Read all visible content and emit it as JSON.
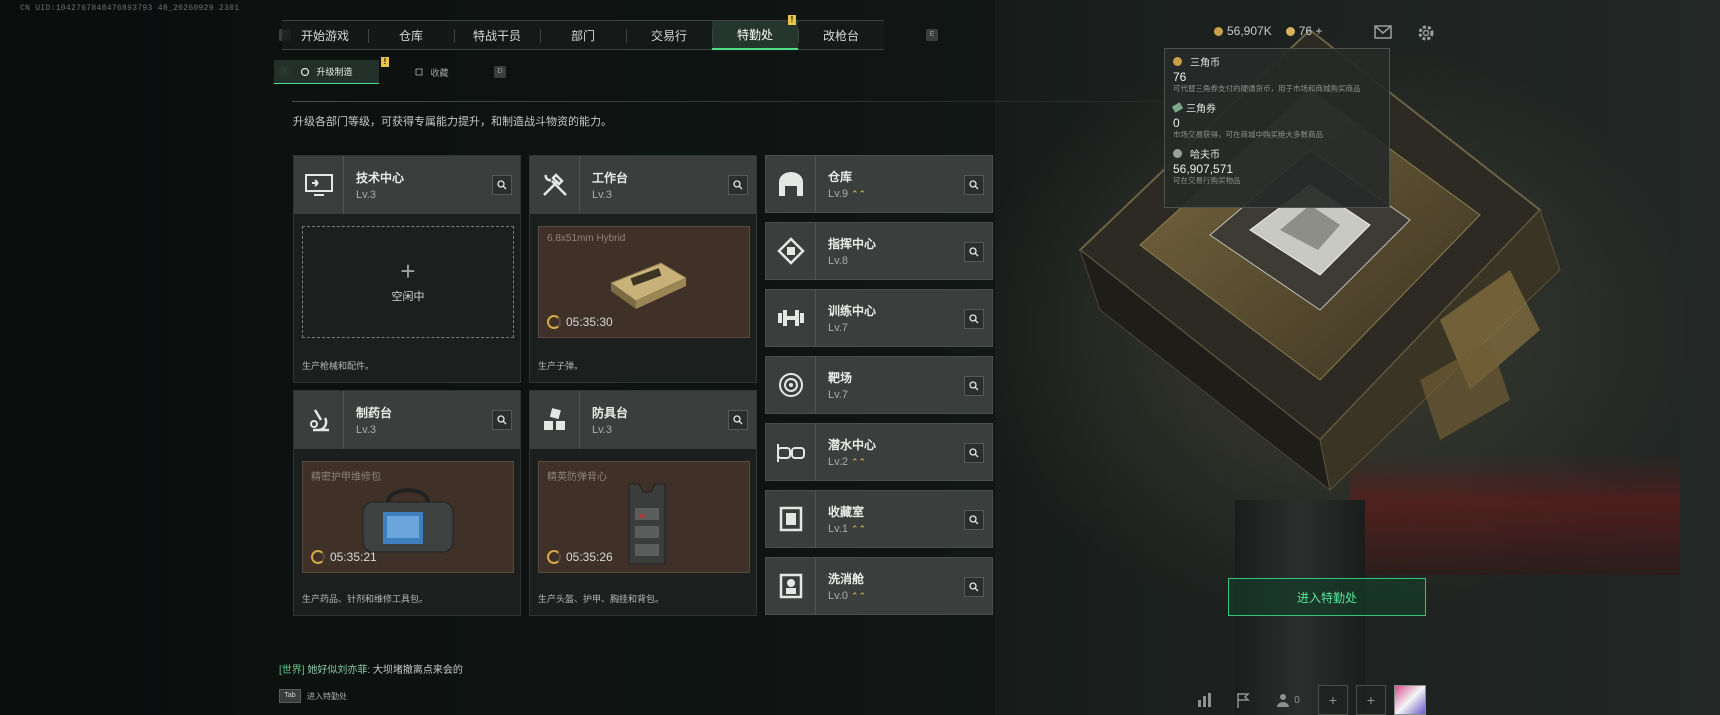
{
  "uid": "CN UID:1042767848476893793 48_20260929 2301",
  "nav": {
    "left_key": "Q",
    "right_key": "E",
    "tabs": [
      {
        "label": "开始游戏"
      },
      {
        "label": "仓库"
      },
      {
        "label": "特战干员"
      },
      {
        "label": "部门"
      },
      {
        "label": "交易行"
      },
      {
        "label": "特勤处",
        "active": true,
        "badge": "!"
      },
      {
        "label": "改枪台"
      }
    ]
  },
  "subnav": {
    "left_key": "A",
    "right_key": "D",
    "tabs": [
      {
        "label": "升级制造",
        "active": true,
        "badge": "!"
      },
      {
        "label": "收藏"
      }
    ]
  },
  "description": "升级各部门等级，可获得专属能力提升，和制造战斗物资的能力。",
  "cards": [
    {
      "title": "技术中心",
      "level": "Lv.3",
      "status": "idle",
      "idle_plus": "+",
      "idle_label": "空闲中",
      "footer": "生产枪械和配件。"
    },
    {
      "title": "工作台",
      "level": "Lv.3",
      "status": "busy",
      "product": "6.8x51mm Hybrid",
      "timer": "05:35:30",
      "footer": "生产子弹。"
    },
    {
      "title": "制药台",
      "level": "Lv.3",
      "status": "busy",
      "product": "精密护甲维修包",
      "timer": "05:35:21",
      "footer": "生产药品、针剂和维修工具包。"
    },
    {
      "title": "防具台",
      "level": "Lv.3",
      "status": "busy",
      "product": "精英防弹背心",
      "timer": "05:35:26",
      "footer": "生产头盔、护甲、胸挂和背包。"
    }
  ],
  "list": [
    {
      "title": "仓库",
      "level": "Lv.9",
      "upgrade": true,
      "icon": "warehouse-icon"
    },
    {
      "title": "指挥中心",
      "level": "Lv.8",
      "upgrade": false,
      "icon": "command-icon"
    },
    {
      "title": "训练中心",
      "level": "Lv.7",
      "upgrade": false,
      "icon": "dumbbell-icon"
    },
    {
      "title": "靶场",
      "level": "Lv.7",
      "upgrade": false,
      "icon": "target-icon"
    },
    {
      "title": "潜水中心",
      "level": "Lv.2",
      "upgrade": true,
      "icon": "diving-mask-icon"
    },
    {
      "title": "收藏室",
      "level": "Lv.1",
      "upgrade": true,
      "icon": "collection-icon"
    },
    {
      "title": "洗消舱",
      "level": "Lv.0",
      "upgrade": true,
      "icon": "decon-icon"
    }
  ],
  "currency_bar": {
    "haf_coin": "56,907K",
    "tri_coin": "76",
    "plus": "+"
  },
  "popover": {
    "tri_coin": {
      "title": "三角币",
      "value": "76",
      "desc": "可代替三角券支付的硬通货币，用于市场和商城购买商品"
    },
    "tri_ticket": {
      "title": "三角券",
      "value": "0",
      "desc": "市场交易获得，可在商城中购买绝大多数商品"
    },
    "haf_coin": {
      "title": "哈夫币",
      "value": "56,907,571",
      "desc": "可在交易行购买物品"
    }
  },
  "enter_button": "进入特勤处",
  "chat": {
    "channel": "[世界]",
    "sender": "她好似刘亦菲:",
    "message": "大坝堵撤离点来会的"
  },
  "tab_hint": {
    "key": "Tab",
    "label": "进入特勤处"
  },
  "bottom_bar": {
    "friends_count": "0"
  },
  "colors": {
    "accent_green": "#4de08b",
    "badge_yellow": "#e6c34a",
    "brown_panel": "#3f3128"
  }
}
